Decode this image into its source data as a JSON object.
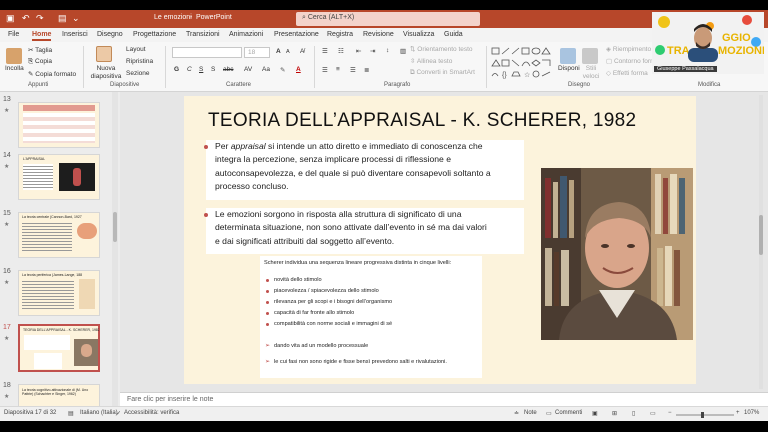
{
  "window": {
    "title": "Le emozioni",
    "app": "PowerPoint",
    "search_placeholder": "Cerca (ALT+X)"
  },
  "tabs": [
    "File",
    "Home",
    "Inserisci",
    "Disegno",
    "Progettazione",
    "Transizioni",
    "Animazioni",
    "Presentazione",
    "Registra",
    "Revisione",
    "Visualizza",
    "Guida"
  ],
  "ribbon": {
    "clipboard": {
      "paste": "Incolla",
      "cut": "Taglia",
      "copy": "Copia",
      "format_painter": "Copia formato",
      "group": "Appunti"
    },
    "slides": {
      "new_slide": "Nuova diapositiva",
      "layout": "Layout",
      "reset": "Ripristina",
      "section": "Sezione",
      "group": "Diapositive"
    },
    "font": {
      "group": "Carattere",
      "size": "18"
    },
    "paragraph": {
      "text_direction": "Orientamento testo",
      "align_text": "Allinea testo",
      "smartart": "Converti in SmartArt",
      "group": "Paragrafo"
    },
    "drawing": {
      "arrange": "Disponi",
      "quick_styles": "Stili veloci",
      "fill": "Riempimento",
      "outline": "Contorno forma",
      "effects": "Effetti forma",
      "group": "Disegno"
    },
    "editing": {
      "group": "Modifica"
    }
  },
  "webcam": {
    "text1": "GGIO",
    "text2": "TRA",
    "text3": "MOZIONI",
    "name": "Giuseppe Passalacqua"
  },
  "thumbnails": [
    {
      "num": "13",
      "title": "",
      "selected": false
    },
    {
      "num": "14",
      "title": "L'APPRAISAL",
      "selected": false
    },
    {
      "num": "15",
      "title": "La teoria centrale (Cannon-Bard, 1927)",
      "selected": false
    },
    {
      "num": "16",
      "title": "La teoria periferica (James-Lange, 1884)",
      "selected": false
    },
    {
      "num": "17",
      "title": "TEORIA DELL'APPRAISAL - K. SCHERER, 1982",
      "selected": true
    },
    {
      "num": "18",
      "title": "La teoria cognitivo-attivazionale di (M. Uno Pattrie) (Schachter e Singer, 1962)",
      "selected": false
    }
  ],
  "slide": {
    "title": "TEORIA DELL’APPRAISAL  - K. SCHERER, 1982",
    "p1_lines": [
      "Per appraisal si intende un atto diretto e immediato di conoscenza che",
      "integra la percezione, senza implicare processi di riflessione e",
      "autoconsapevolezza, e del quale si può diventare consapevoli soltanto a",
      "processo concluso."
    ],
    "p2_lines": [
      "Le emozioni sorgono in risposta alla struttura di significato di una",
      "determinata situazione, non sono attivate dall’evento in sé ma dai valori",
      "e dai significati attribuiti dal soggetto all’evento."
    ],
    "box_intro": "Scherer individua una sequenza lineare progressiva distinta in cinque livelli:",
    "levels": [
      "novità dello stimolo",
      "piacevolezza / spiacevolezza dello stimolo",
      "rilevanza per gli scopi e i bisogni dell’organismo",
      "capacità di far fronte allo stimolo",
      "compatibilità con norme sociali e immagini di sé"
    ],
    "conclusions": [
      "dando vita ad un modello processuale",
      "le cui fasi non sono rigide e fisse bensì prevedono salti e rivalutazioni."
    ]
  },
  "notes_placeholder": "Fare clic per inserire le note",
  "status": {
    "slide": "Diapositiva 17 di 32",
    "language": "Italiano (Italia)",
    "accessibility": "Accessibilità: verifica",
    "notes": "Note",
    "comments": "Commenti",
    "zoom": "107%"
  },
  "colors": {
    "accent": "#b7472a",
    "bullet": "#c0504d",
    "slide_bg": "#fcf3dc"
  }
}
